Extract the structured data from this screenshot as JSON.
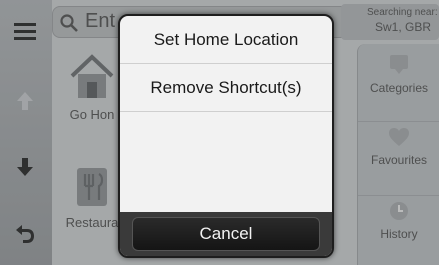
{
  "search": {
    "text": "Ent",
    "near_label": "Searching near:",
    "near_value": "Sw1, GBR"
  },
  "tiles": {
    "home": {
      "label": "Go Hon"
    },
    "restaurants": {
      "label": "Restaura"
    }
  },
  "right_panel": {
    "categories": "Categories",
    "favourites": "Favourites",
    "history": "History"
  },
  "dialog": {
    "options": [
      "Set Home Location",
      "Remove Shortcut(s)"
    ],
    "cancel_label": "Cancel"
  },
  "colors": {
    "dialog_bg": "#f2f2f2",
    "cancel_bg": "#1a1a1a",
    "background": "#c9cbcd"
  },
  "icons": [
    "menu-icon",
    "up-arrow-icon",
    "down-arrow-icon",
    "back-icon",
    "search-icon",
    "home-icon",
    "restaurant-icon",
    "categories-icon",
    "favourites-icon",
    "history-icon"
  ]
}
